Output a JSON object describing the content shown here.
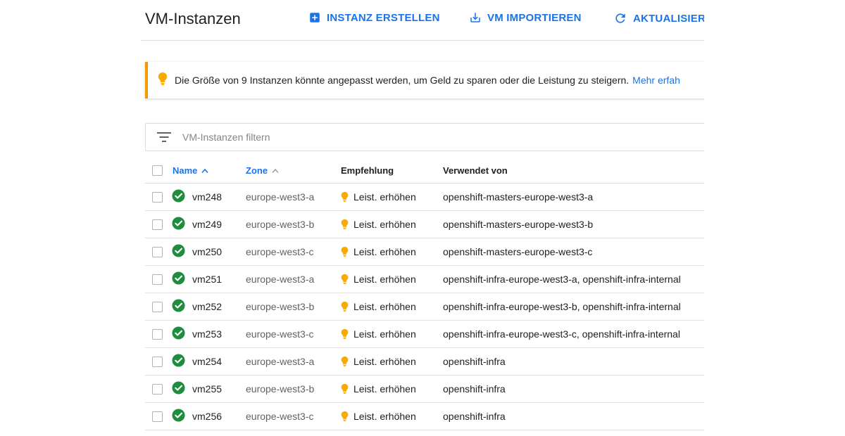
{
  "header": {
    "title": "VM-Instanzen",
    "create_label": "INSTANZ ERSTELLEN",
    "import_label": "VM IMPORTIEREN",
    "refresh_label": "AKTUALISIERE"
  },
  "banner": {
    "text": "Die Größe von 9 Instanzen könnte angepasst werden, um Geld zu sparen oder die Leistung zu steigern.",
    "link": "Mehr erfah"
  },
  "filter": {
    "placeholder": "VM-Instanzen filtern"
  },
  "table": {
    "columns": {
      "name": "Name",
      "zone": "Zone",
      "recommendation": "Empfehlung",
      "used_by": "Verwendet von"
    },
    "rows": [
      {
        "name": "vm248",
        "zone": "europe-west3-a",
        "recommendation": "Leist. erhöhen",
        "used_by": "openshift-masters-europe-west3-a"
      },
      {
        "name": "vm249",
        "zone": "europe-west3-b",
        "recommendation": "Leist. erhöhen",
        "used_by": "openshift-masters-europe-west3-b"
      },
      {
        "name": "vm250",
        "zone": "europe-west3-c",
        "recommendation": "Leist. erhöhen",
        "used_by": "openshift-masters-europe-west3-c"
      },
      {
        "name": "vm251",
        "zone": "europe-west3-a",
        "recommendation": "Leist. erhöhen",
        "used_by": "openshift-infra-europe-west3-a, openshift-infra-internal"
      },
      {
        "name": "vm252",
        "zone": "europe-west3-b",
        "recommendation": "Leist. erhöhen",
        "used_by": "openshift-infra-europe-west3-b, openshift-infra-internal"
      },
      {
        "name": "vm253",
        "zone": "europe-west3-c",
        "recommendation": "Leist. erhöhen",
        "used_by": "openshift-infra-europe-west3-c, openshift-infra-internal"
      },
      {
        "name": "vm254",
        "zone": "europe-west3-a",
        "recommendation": "Leist. erhöhen",
        "used_by": "openshift-infra"
      },
      {
        "name": "vm255",
        "zone": "europe-west3-b",
        "recommendation": "Leist. erhöhen",
        "used_by": "openshift-infra"
      },
      {
        "name": "vm256",
        "zone": "europe-west3-c",
        "recommendation": "Leist. erhöhen",
        "used_by": "openshift-infra"
      }
    ]
  },
  "colors": {
    "accent": "#1a73e8",
    "status_ok": "#1e8e3e",
    "warning": "#f9ab00",
    "banner_border": "#f29900"
  },
  "icons": {
    "create": "add-box-icon",
    "import": "download-icon",
    "refresh": "refresh-icon",
    "banner": "lightbulb-icon",
    "filter": "filter-list-icon",
    "status": "check-circle-icon",
    "recommendation": "lightbulb-icon"
  }
}
